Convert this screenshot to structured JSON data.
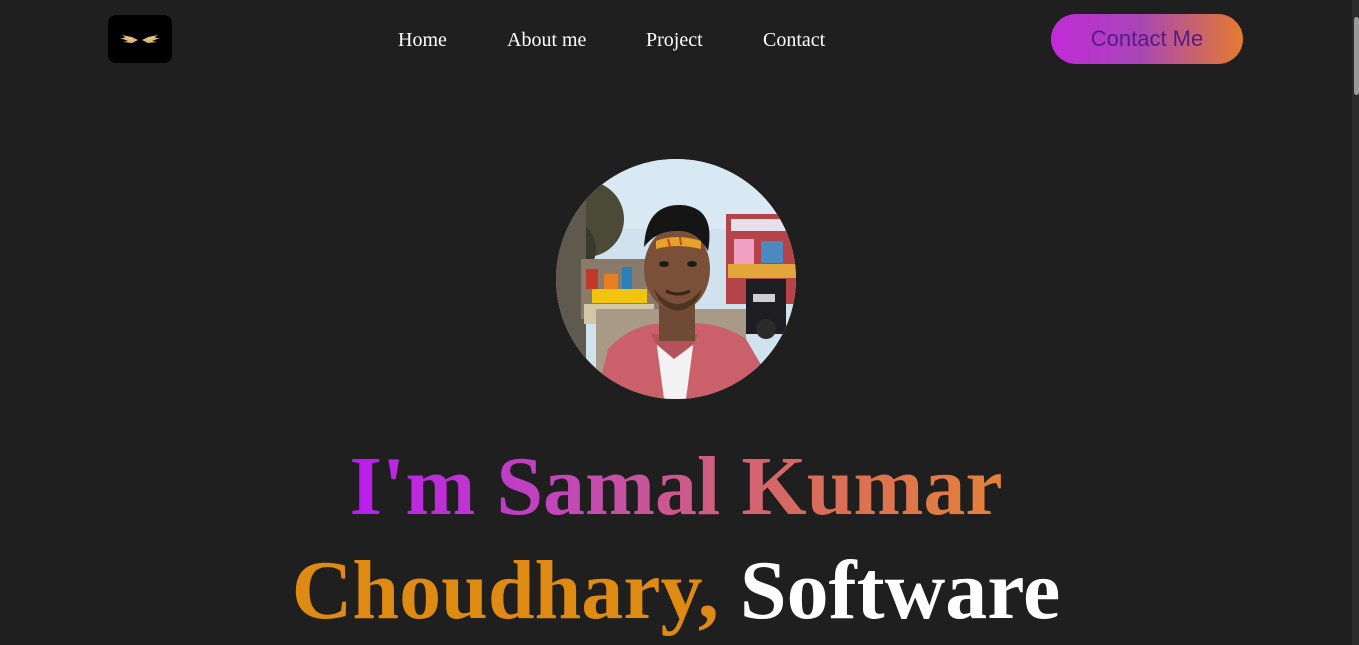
{
  "header": {
    "logo_icon": "wings-logo-icon",
    "nav": [
      "Home",
      "About me",
      "Project",
      "Contact"
    ],
    "cta_label": "Contact Me"
  },
  "hero": {
    "avatar": "profile-photo",
    "greeting": "I'm Samal Kumar",
    "name_end": "Choudhary,",
    "role": "Software"
  },
  "colors": {
    "background": "#1f1f1f",
    "accent_purple": "#b91cf0",
    "accent_orange": "#e5813a"
  }
}
